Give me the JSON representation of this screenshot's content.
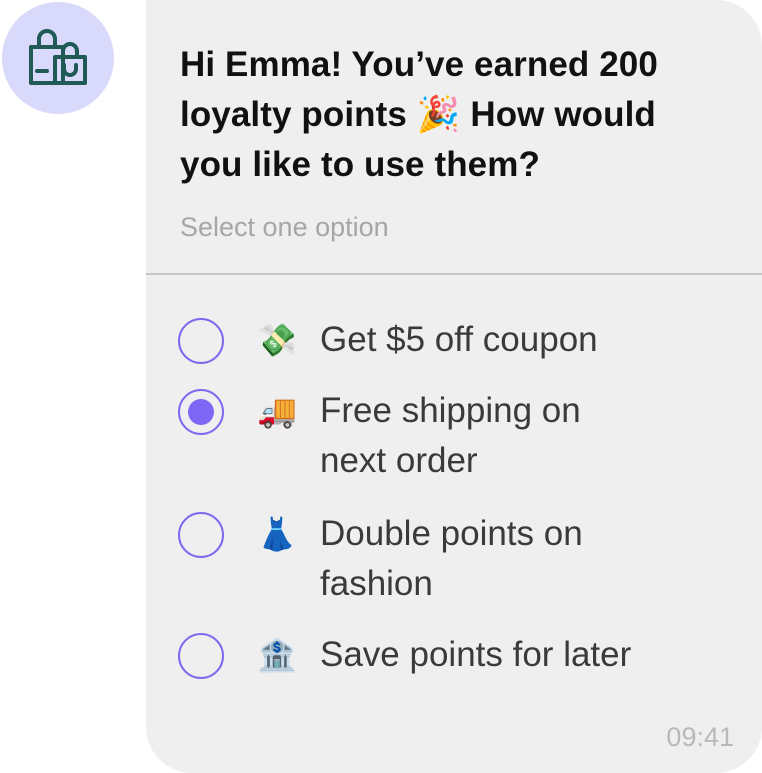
{
  "message": {
    "title": "Hi Emma! You’ve earned 200 loyalty points 🎉 How would you like to use them?",
    "hint": "Select one option",
    "time": "09:41"
  },
  "options": [
    {
      "emoji": "💸",
      "label": "Get $5 off coupon",
      "selected": false
    },
    {
      "emoji": "🚚",
      "label": "Free shipping on next order",
      "selected": true
    },
    {
      "emoji": "👗",
      "label": "Double points on fashion",
      "selected": false
    },
    {
      "emoji": "🏦",
      "label": "Save points for later",
      "selected": false
    }
  ],
  "colors": {
    "accent": "#7f67f5",
    "avatar_bg": "#d9d9fb",
    "avatar_icon": "#1f5a56",
    "bubble_bg": "#efefef"
  },
  "icons": {
    "avatar": "shopping-bags-icon"
  }
}
